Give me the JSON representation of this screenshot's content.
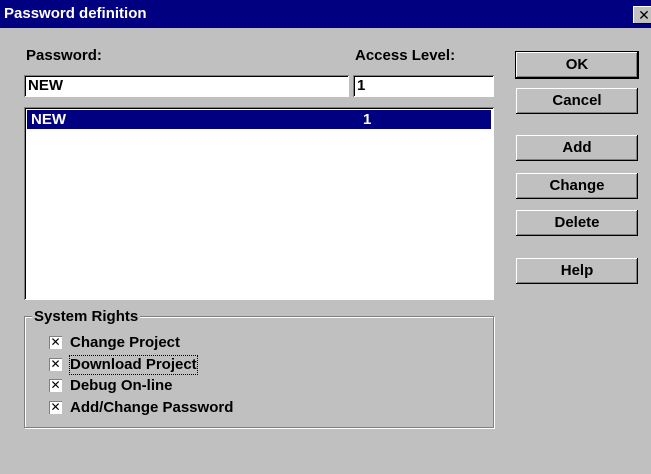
{
  "window": {
    "title": "Password definition",
    "close_glyph": "✕"
  },
  "password": {
    "label": "Password:",
    "value": "NEW"
  },
  "access_level": {
    "label": "Access Level:",
    "value": "1"
  },
  "list": {
    "rows": [
      {
        "password": "NEW",
        "level": "1"
      }
    ]
  },
  "buttons": {
    "ok": "OK",
    "cancel": "Cancel",
    "add": "Add",
    "change": "Change",
    "delete": "Delete",
    "help": "Help"
  },
  "system_rights": {
    "title": "System Rights",
    "items": [
      {
        "label": "Change Project",
        "checked": true
      },
      {
        "label": "Download Project",
        "checked": true
      },
      {
        "label": "Debug On-line",
        "checked": true
      },
      {
        "label": "Add/Change Password",
        "checked": true
      }
    ]
  },
  "colors": {
    "title_bar": "#000080",
    "face": "#c0c0c0",
    "selection": "#000080"
  },
  "icons": {
    "close": "close-icon",
    "check": "check-icon"
  }
}
